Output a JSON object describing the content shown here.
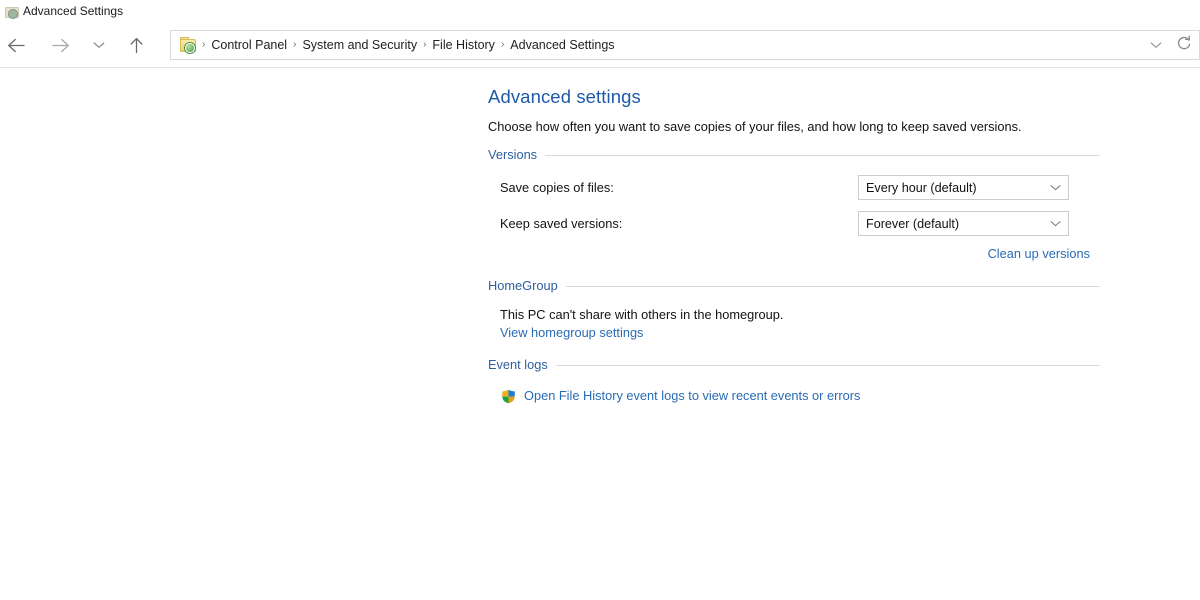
{
  "window": {
    "title": "Advanced Settings",
    "title_icon": "folder-globe-icon"
  },
  "navigation": {
    "back_icon": "back-arrow-icon",
    "forward_icon": "forward-arrow-icon",
    "recent_icon": "chevron-down-icon",
    "up_icon": "up-arrow-icon",
    "address_icon": "folder-globe-icon",
    "address_chevron_icon": "chevron-down-icon",
    "refresh_icon": "refresh-icon",
    "breadcrumbs": [
      "Control Panel",
      "System and Security",
      "File History",
      "Advanced Settings"
    ],
    "separator": "›"
  },
  "page": {
    "title": "Advanced settings",
    "description": "Choose how often you want to save copies of your files, and how long to keep saved versions."
  },
  "groups": {
    "versions": {
      "label": "Versions",
      "save_copies_label": "Save copies of files:",
      "save_copies_value": "Every hour (default)",
      "keep_versions_label": "Keep saved versions:",
      "keep_versions_value": "Forever (default)",
      "clean_up_link": "Clean up versions"
    },
    "homegroup": {
      "label": "HomeGroup",
      "message": "This PC can't share with others in the homegroup.",
      "link": "View homegroup settings"
    },
    "event_logs": {
      "label": "Event logs",
      "link": "Open File History event logs to view recent events or errors",
      "link_icon": "uac-shield-icon"
    }
  },
  "colors": {
    "title_blue": "#1f5aa8",
    "group_label_blue": "#2f5f9e",
    "link_blue": "#2a6bb5",
    "rule_gray": "#d8d8d8",
    "border_gray": "#cccccc"
  }
}
